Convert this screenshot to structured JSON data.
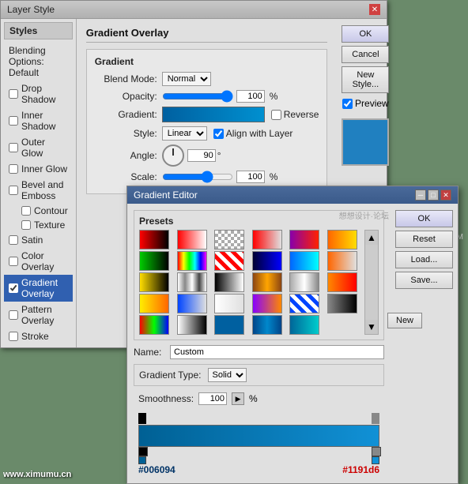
{
  "layerStyleDialog": {
    "title": "Layer Style",
    "sidebar": {
      "title": "Styles",
      "items": [
        {
          "id": "blending-options",
          "label": "Blending Options: Default",
          "type": "header",
          "checked": false
        },
        {
          "id": "drop-shadow",
          "label": "Drop Shadow",
          "type": "checkbox",
          "checked": false
        },
        {
          "id": "inner-shadow",
          "label": "Inner Shadow",
          "type": "checkbox",
          "checked": false
        },
        {
          "id": "outer-glow",
          "label": "Outer Glow",
          "type": "checkbox",
          "checked": false
        },
        {
          "id": "inner-glow",
          "label": "Inner Glow",
          "type": "checkbox",
          "checked": false
        },
        {
          "id": "bevel-emboss",
          "label": "Bevel and Emboss",
          "type": "checkbox",
          "checked": false
        },
        {
          "id": "contour",
          "label": "Contour",
          "type": "sub-checkbox",
          "checked": false
        },
        {
          "id": "texture",
          "label": "Texture",
          "type": "sub-checkbox",
          "checked": false
        },
        {
          "id": "satin",
          "label": "Satin",
          "type": "checkbox",
          "checked": false
        },
        {
          "id": "color-overlay",
          "label": "Color Overlay",
          "type": "checkbox",
          "checked": false
        },
        {
          "id": "gradient-overlay",
          "label": "Gradient Overlay",
          "type": "checkbox",
          "checked": true,
          "active": true
        },
        {
          "id": "pattern-overlay",
          "label": "Pattern Overlay",
          "type": "checkbox",
          "checked": false
        },
        {
          "id": "stroke",
          "label": "Stroke",
          "type": "checkbox",
          "checked": false
        }
      ]
    },
    "panel": {
      "title": "Gradient Overlay",
      "gradient": {
        "sectionTitle": "Gradient",
        "blendModeLabel": "Blend Mode:",
        "blendModeValue": "Normal",
        "opacityLabel": "Opacity:",
        "opacityValue": "100",
        "opacityUnit": "%",
        "gradientLabel": "Gradient:",
        "reverseLabel": "Reverse",
        "styleLabel": "Style:",
        "styleValue": "Linear",
        "alignWithLayerLabel": "Align with Layer",
        "angleLabel": "Angle:",
        "angleValue": "90",
        "angleDegree": "°",
        "scaleLabel": "Scale:",
        "scaleValue": "100",
        "scaleUnit": "%"
      }
    },
    "buttons": {
      "ok": "OK",
      "cancel": "Cancel",
      "newStyle": "New Style...",
      "preview": "Preview"
    }
  },
  "gradientEditorDialog": {
    "title": "Gradient Editor",
    "presets": {
      "title": "Presets",
      "swatches": [
        "gs-red-black",
        "gs-red-white",
        "gs-checker",
        "gs-red-tr",
        "gs-purple-red",
        "gs-orange-yellow",
        "gs-green-black",
        "gs-rainbow",
        "gs-red-stripe",
        "gs-dark-blue",
        "gs-blue-cyan",
        "gs-orange-tr",
        "gs-yellow-black",
        "gs-chrome",
        "gs-black-white",
        "gs-copper",
        "gs-steel",
        "gs-orange-red",
        "gs-yellow-orange",
        "gs-blue-tr",
        "gs-white-tr",
        "gs-violet-orange",
        "gs-blue-stripe",
        "gs-gray-black",
        "gs-multicolor",
        "gs-white-black",
        "gs-blue-solid",
        "gs-blue-light",
        "gs-teal"
      ]
    },
    "nameLabel": "Name:",
    "nameValue": "Custom",
    "newButtonLabel": "New",
    "gradientTypeLabel": "Gradient Type:",
    "gradientTypeValue": "Solid",
    "smoothnessLabel": "Smoothness:",
    "smoothnessValue": "100",
    "smoothnessUnit": "%",
    "colorStops": {
      "leftColor": "#006094",
      "rightColor": "#1191d6"
    },
    "buttons": {
      "ok": "OK",
      "reset": "Reset",
      "load": "Load...",
      "save": "Save..."
    }
  },
  "watermark": {
    "left": "www.ximumu.cn",
    "center": "想想设计·论坛",
    "right": "WWW.MISSYUAN.COM"
  }
}
